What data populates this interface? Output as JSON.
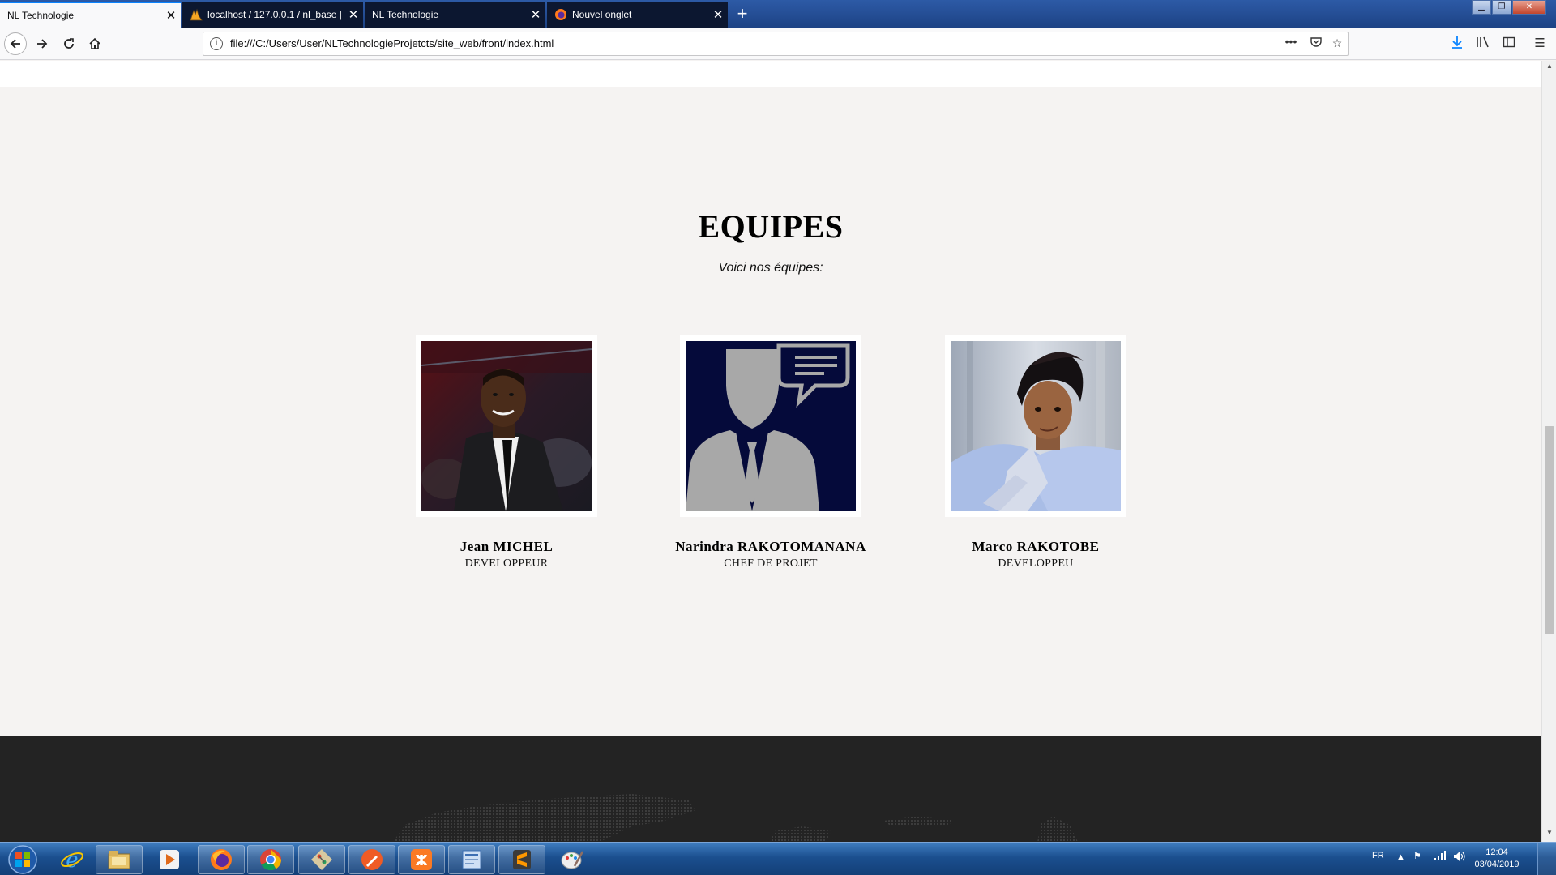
{
  "browser": {
    "tabs": [
      {
        "title": "NL Technologie",
        "active": true,
        "icon": "blank"
      },
      {
        "title": "localhost / 127.0.0.1 / nl_base |",
        "active": false,
        "icon": "phpmyadmin-icon"
      },
      {
        "title": "NL Technologie",
        "active": false,
        "icon": "blank"
      },
      {
        "title": "Nouvel onglet",
        "active": false,
        "icon": "firefox-icon"
      }
    ],
    "url": "file:///C:/Users/User/NLTechnologieProjetcts/site_web/front/index.html",
    "page_actions": "•••"
  },
  "page": {
    "section_title": "EQUIPES",
    "section_subtitle": "Voici nos équipes:",
    "members": [
      {
        "name": "Jean MICHEL",
        "role": "DEVELOPPEUR",
        "photo": "man-in-suit-photo"
      },
      {
        "name": "Narindra RAKOTOMANANA",
        "role": "CHEF DE PROJET",
        "photo": "person-placeholder-icon"
      },
      {
        "name": "Marco RAKOTOBE",
        "role": "DEVELOPPEU",
        "photo": "young-man-photo"
      }
    ]
  },
  "taskbar": {
    "language": "FR",
    "time": "12:04",
    "date": "03/04/2019",
    "apps": [
      "internet-explorer-icon",
      "file-explorer-icon",
      "media-player-icon",
      "firefox-icon",
      "chrome-icon",
      "git-icon",
      "postman-icon",
      "xampp-icon",
      "document-viewer-icon",
      "sublime-text-icon",
      "paint-icon"
    ]
  },
  "colors": {
    "page_bg": "#f5f3f2",
    "footer_bg": "#232323",
    "tabstrip_bg": "#1d4385",
    "placeholder_bg": "#050a3a",
    "placeholder_fg": "#a8a8a8"
  }
}
